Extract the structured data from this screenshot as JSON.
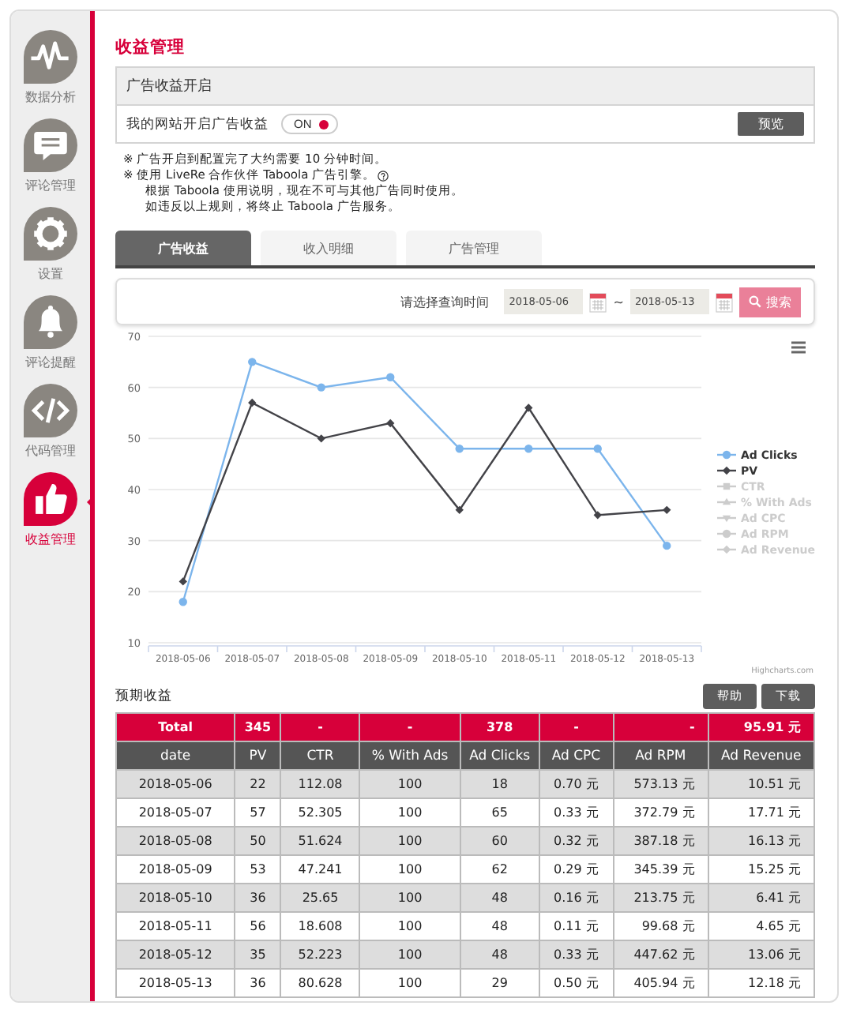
{
  "sidebar": {
    "items": [
      {
        "kind": "pulse",
        "label": "数据分析",
        "selected": false
      },
      {
        "kind": "chat",
        "label": "评论管理",
        "selected": false
      },
      {
        "kind": "gear",
        "label": "设置",
        "selected": false
      },
      {
        "kind": "bell",
        "label": "评论提醒",
        "selected": false
      },
      {
        "kind": "code",
        "label": "代码管理",
        "selected": false
      },
      {
        "kind": "thumb",
        "label": "收益管理",
        "selected": true
      }
    ]
  },
  "page_title": "收益管理",
  "ad_panel": {
    "header": "广告收益开启",
    "label": "我的网站开启广告收益",
    "toggle": {
      "label": "ON",
      "on": true
    },
    "preview_button": "预览"
  },
  "notes": [
    {
      "kind": "mark",
      "text": "※ 广告开启到配置完了大约需要 10 分钟时间。",
      "help": false
    },
    {
      "kind": "mark",
      "text": "※ 使用 LiveRe 合作伙伴 Taboola 广告引擎。",
      "help": true
    },
    {
      "kind": "sub",
      "text": "根据 Taboola 使用说明，现在不可与其他广告同时使用。",
      "help": false
    },
    {
      "kind": "sub",
      "text": "如违反以上规则，将终止 Taboola 广告服务。",
      "help": false
    }
  ],
  "tabs": [
    {
      "label": "广告收益",
      "selected": true
    },
    {
      "label": "收入明细",
      "selected": false
    },
    {
      "label": "广告管理",
      "selected": false
    }
  ],
  "filter": {
    "label": "请选择查询时间",
    "from": "2018-05-06",
    "separator": "~",
    "to": "2018-05-13",
    "search_button": "搜索"
  },
  "chart": {
    "credit": "Highcharts.com",
    "chart_data": {
      "type": "line",
      "grid": true,
      "legend": "right",
      "categories": [
        "2018-05-06",
        "2018-05-07",
        "2018-05-08",
        "2018-05-09",
        "2018-05-10",
        "2018-05-11",
        "2018-05-12",
        "2018-05-13"
      ],
      "ylim": [
        10,
        70
      ],
      "yticks": [
        10,
        20,
        30,
        40,
        50,
        60,
        70
      ],
      "series": [
        {
          "name": "Ad Clicks",
          "color": "#7cb5ec",
          "marker": "circle",
          "values": [
            18,
            65,
            60,
            62,
            48,
            48,
            48,
            29
          ]
        },
        {
          "name": "PV",
          "color": "#434348",
          "marker": "diamond",
          "values": [
            22,
            57,
            50,
            53,
            36,
            56,
            35,
            36
          ]
        }
      ]
    },
    "hidden_legend": [
      {
        "name": "CTR",
        "kind": "square"
      },
      {
        "name": "% With Ads",
        "kind": "triangle"
      },
      {
        "name": "Ad CPC",
        "kind": "triangle-down"
      },
      {
        "name": "Ad RPM",
        "kind": "circle"
      },
      {
        "name": "Ad Revenue",
        "kind": "diamond"
      }
    ]
  },
  "forecast": {
    "title": "预期收益",
    "buttons": [
      "帮助",
      "下载"
    ],
    "total": [
      "Total",
      "345",
      "-",
      "-",
      "378",
      "-",
      "-",
      "95.91 元"
    ],
    "columns": [
      "date",
      "PV",
      "CTR",
      "% With Ads",
      "Ad Clicks",
      "Ad CPC",
      "Ad RPM",
      "Ad Revenue"
    ],
    "rows": [
      [
        "2018-05-06",
        "22",
        "112.08",
        "100",
        "18",
        "0.70 元",
        "573.13 元",
        "10.51 元"
      ],
      [
        "2018-05-07",
        "57",
        "52.305",
        "100",
        "65",
        "0.33 元",
        "372.79 元",
        "17.71 元"
      ],
      [
        "2018-05-08",
        "50",
        "51.624",
        "100",
        "60",
        "0.32 元",
        "387.18 元",
        "16.13 元"
      ],
      [
        "2018-05-09",
        "53",
        "47.241",
        "100",
        "62",
        "0.29 元",
        "345.39 元",
        "15.25 元"
      ],
      [
        "2018-05-10",
        "36",
        "25.65",
        "100",
        "48",
        "0.16 元",
        "213.75 元",
        "6.41 元"
      ],
      [
        "2018-05-11",
        "56",
        "18.608",
        "100",
        "48",
        "0.11 元",
        "99.68 元",
        "4.65 元"
      ],
      [
        "2018-05-12",
        "35",
        "52.223",
        "100",
        "48",
        "0.33 元",
        "447.62 元",
        "13.06 元"
      ],
      [
        "2018-05-13",
        "36",
        "80.628",
        "100",
        "29",
        "0.50 元",
        "405.94 元",
        "12.18 元"
      ]
    ]
  }
}
